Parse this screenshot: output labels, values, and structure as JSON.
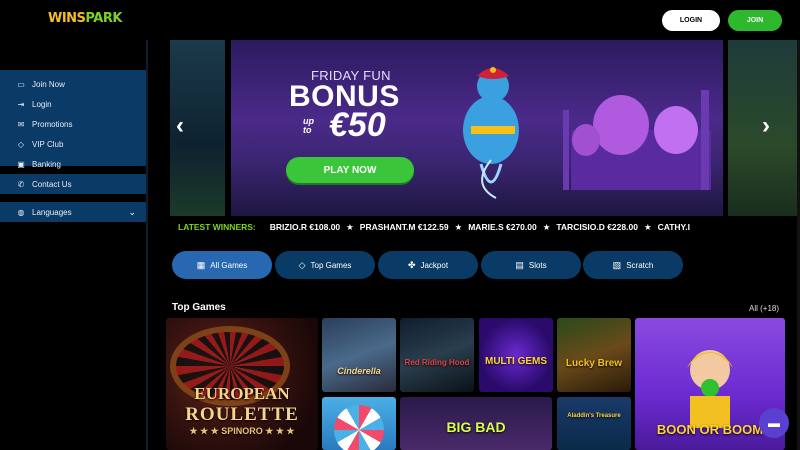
{
  "header": {
    "logo_part1": "WINS",
    "logo_part2": "PARK",
    "login_label": "LOGIN",
    "join_label": "JOIN"
  },
  "sidebar": {
    "items": [
      {
        "label": "Join Now",
        "icon": "join-icon"
      },
      {
        "label": "Login",
        "icon": "login-icon"
      },
      {
        "label": "Promotions",
        "icon": "promotions-icon"
      },
      {
        "label": "VIP Club",
        "icon": "diamond-icon"
      },
      {
        "label": "Banking",
        "icon": "banking-icon"
      }
    ],
    "contact_label": "Contact Us",
    "languages_label": "Languages"
  },
  "hero": {
    "friday": "FRIDAY FUN",
    "bonus": "BONUS",
    "upto_line1": "up",
    "upto_line2": "to",
    "amount": "€50",
    "cta": "PLAY NOW"
  },
  "winners": {
    "label": "LATEST WINNERS:",
    "entries": [
      "BRIZIO.R €108.00",
      "PRASHANT.M €122.59",
      "MARIE.S €270.00",
      "TARCISIO.D €228.00",
      "CATHY.I"
    ]
  },
  "categories": [
    {
      "label": "All Games",
      "icon": "grid-icon",
      "active": true
    },
    {
      "label": "Top Games",
      "icon": "diamond-icon",
      "active": false
    },
    {
      "label": "Jackpot",
      "icon": "clover-icon",
      "active": false
    },
    {
      "label": "Slots",
      "icon": "slots-icon",
      "active": false
    },
    {
      "label": "Scratch",
      "icon": "scratch-icon",
      "active": false
    }
  ],
  "top_games": {
    "title": "Top Games",
    "all_label": "All (+18)",
    "tiles": {
      "roulette_l1": "EUROPEAN",
      "roulette_l2": "ROULETTE",
      "roulette_l3": "★ ★ ★ SPINORO ★ ★ ★",
      "cinderella": "Cinderella",
      "red_riding": "Red Riding Hood",
      "multi_gems": "MULTI GEMS",
      "lucky_brew": "Lucky Brew",
      "boon_or_boom": "BOON OR BOOM",
      "big_bad": "BIG BAD",
      "aladdin": "Aladdin's Treasure"
    }
  },
  "colors": {
    "sidebar_bg": "#0a3a66",
    "accent_green": "#3ac53a",
    "active_tab": "#2768b0"
  }
}
